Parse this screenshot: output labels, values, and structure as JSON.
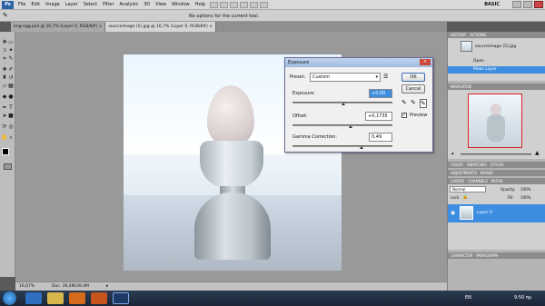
{
  "app": {
    "logo": "Ps",
    "menu": [
      "File",
      "Edit",
      "Image",
      "Layer",
      "Select",
      "Filter",
      "Analysis",
      "3D",
      "View",
      "Window",
      "Help"
    ],
    "workspace": "BASIC"
  },
  "options_bar": {
    "message": "No options for the current tool."
  },
  "tabs": [
    {
      "label": "img-egg.psd @ 16,7% (Layer 0, RGB/8#)",
      "active": false
    },
    {
      "label": "sourceimage (5).jpg @ 16,7% (Layer 0, RGB/8#)",
      "active": true
    }
  ],
  "status": {
    "zoom": "16,67%",
    "doc": "Doc: 39,4M/39,4M"
  },
  "dialog": {
    "title": "Exposure",
    "preset_label": "Preset:",
    "preset_value": "Custom",
    "exposure_label": "Exposure:",
    "exposure_value": "+0,00",
    "offset_label": "Offset:",
    "offset_value": "+0,1735",
    "gamma_label": "Gamma Correction:",
    "gamma_value": "0,49",
    "ok": "OK",
    "cancel": "Cancel",
    "preview_label": "Preview",
    "preview_checked": true
  },
  "panels": {
    "history": {
      "tabs": [
        "HISTORY",
        "ACTIONS"
      ],
      "snapshot": "sourceimage (5).jpg",
      "items": [
        "Open",
        "Make Layer"
      ]
    },
    "navigator": {
      "tabs": [
        "NAVIGATOR"
      ]
    },
    "color": {
      "tabs": [
        "COLOR",
        "SWATCHES",
        "STYLES"
      ]
    },
    "adjustments": {
      "tabs": [
        "ADJUSTMENTS",
        "MASKS"
      ]
    },
    "layers": {
      "tabs": [
        "LAYERS",
        "CHANNELS",
        "PATHS"
      ],
      "blend_mode": "Normal",
      "opacity_label": "Opacity:",
      "opacity_value": "100%",
      "lock_label": "Lock:",
      "fill_label": "Fill:",
      "fill_value": "100%",
      "layer_name": "Layer 0"
    },
    "character": {
      "tabs": [
        "CHARACTER",
        "PARAGRAPH"
      ]
    }
  },
  "taskbar": {
    "lang": "EN",
    "time": "9:50 πμ"
  },
  "colors": {
    "selection": "#3d8ee0",
    "titlebar": "#a8c0e2"
  }
}
